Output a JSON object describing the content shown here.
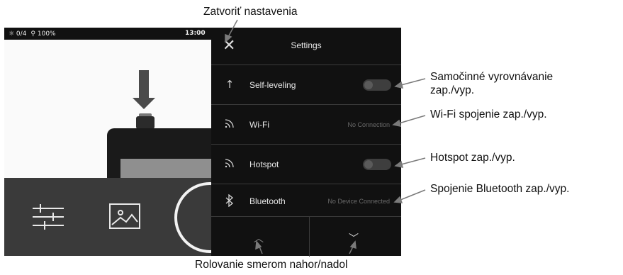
{
  "status_bar": {
    "brightness": "☼ 0/4",
    "zoom": "⚲ 100%",
    "time": "13:00"
  },
  "settings_panel": {
    "close_icon": "close-icon",
    "title": "Settings",
    "rows": [
      {
        "icon": "arrow-up-icon",
        "label": "Self-leveling",
        "control": "toggle"
      },
      {
        "icon": "wifi-icon",
        "label": "Wi-Fi",
        "value": "No Connection"
      },
      {
        "icon": "wifi-icon",
        "label": "Hotspot",
        "control": "toggle"
      },
      {
        "icon": "bluetooth-icon",
        "label": "Bluetooth",
        "value": "No Device Connected"
      }
    ],
    "nav": {
      "up_icon": "chevron-up-icon",
      "down_icon": "chevron-down-icon"
    }
  },
  "callouts": {
    "close_settings": "Zatvoriť nastavenia",
    "self_leveling_line1": "Samočinné vyrovnávanie",
    "self_leveling_line2": "zap./vyp.",
    "wifi": "Wi-Fi spojenie zap./vyp.",
    "hotspot": "Hotspot zap./vyp.",
    "bluetooth": "Spojenie Bluetooth zap./vyp.",
    "scroll": "Rolovanie smerom nahor/nadol"
  },
  "colors": {
    "panel_bg": "#111111",
    "bottom_bar_bg": "#3a3a3a",
    "leader_line": "#7a7a7a"
  }
}
